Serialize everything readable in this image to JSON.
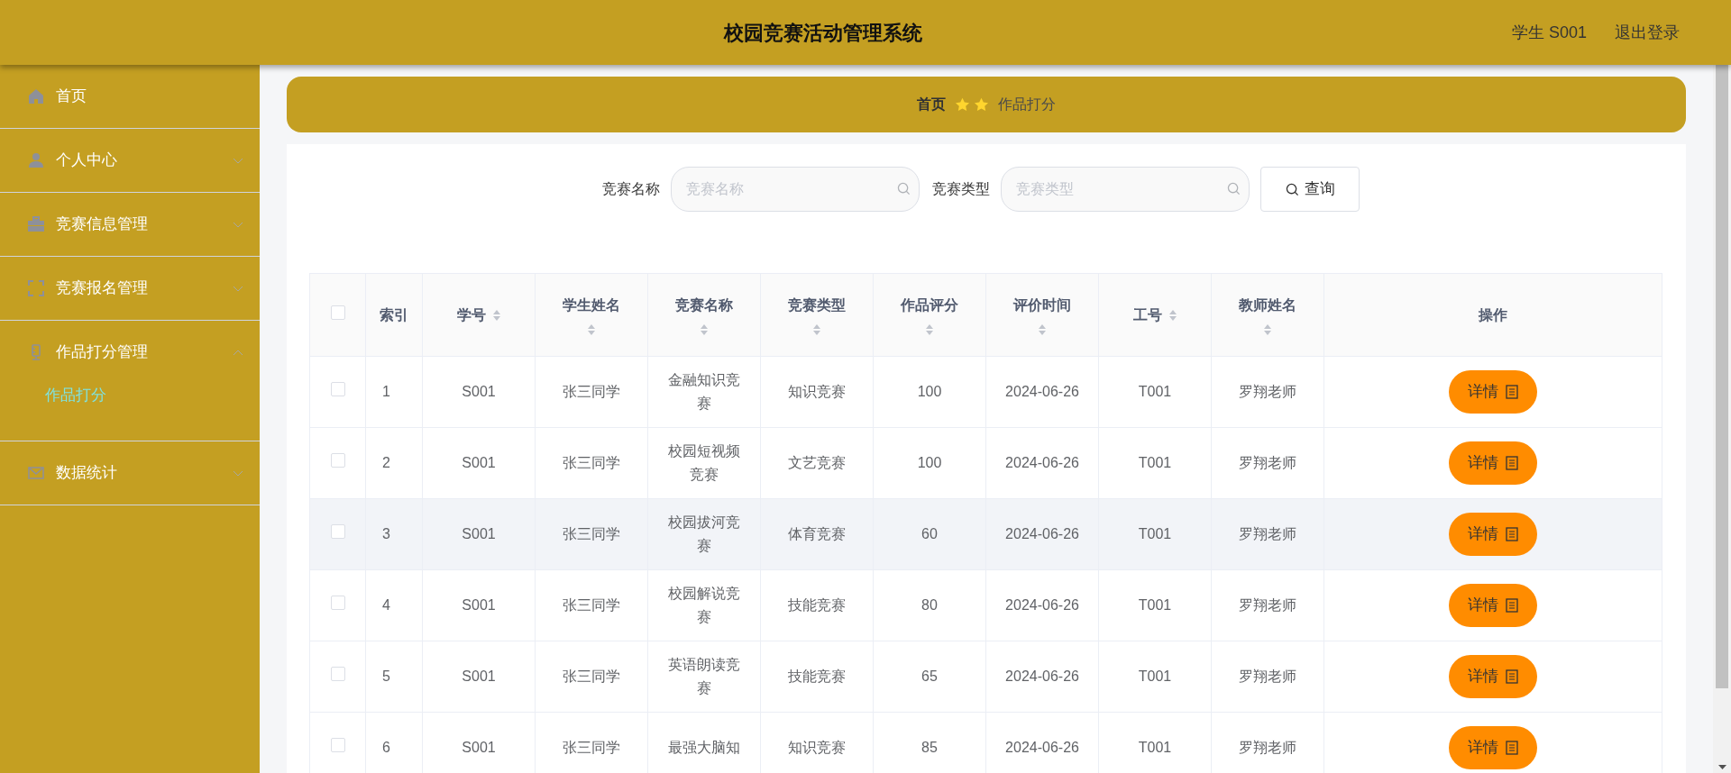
{
  "header": {
    "title": "校园竞赛活动管理系统",
    "user": "学生 S001",
    "logout": "退出登录"
  },
  "sidebar": {
    "items": [
      {
        "label": "首页"
      },
      {
        "label": "个人中心",
        "expanded": false
      },
      {
        "label": "竞赛信息管理",
        "expanded": false
      },
      {
        "label": "竞赛报名管理",
        "expanded": false
      },
      {
        "label": "作品打分管理",
        "expanded": true,
        "children": [
          {
            "label": "作品打分",
            "selected": true
          }
        ]
      },
      {
        "label": "数据统计",
        "expanded": false
      }
    ]
  },
  "breadcrumb": {
    "home": "首页",
    "current": "作品打分"
  },
  "search": {
    "fields": [
      {
        "label": "竞赛名称",
        "placeholder": "竞赛名称"
      },
      {
        "label": "竞赛类型",
        "placeholder": "竞赛类型"
      }
    ],
    "button": "查询"
  },
  "table": {
    "select_all_checked": false,
    "columns": [
      {
        "label": "索引",
        "sortable": false
      },
      {
        "label": "学号",
        "sortable": true
      },
      {
        "label": "学生姓名",
        "sortable": true
      },
      {
        "label": "竞赛名称",
        "sortable": true
      },
      {
        "label": "竞赛类型",
        "sortable": true
      },
      {
        "label": "作品评分",
        "sortable": true
      },
      {
        "label": "评价时间",
        "sortable": true
      },
      {
        "label": "工号",
        "sortable": true
      },
      {
        "label": "教师姓名",
        "sortable": true
      },
      {
        "label": "操作",
        "sortable": false
      }
    ],
    "rows": [
      {
        "checked": false,
        "highlighted": false,
        "cells": [
          "1",
          "S001",
          "张三同学",
          "金融知识竞赛",
          "知识竞赛",
          "100",
          "2024-06-26",
          "T001",
          "罗翔老师"
        ],
        "action": "详情"
      },
      {
        "checked": false,
        "highlighted": false,
        "cells": [
          "2",
          "S001",
          "张三同学",
          "校园短视频竞赛",
          "文艺竞赛",
          "100",
          "2024-06-26",
          "T001",
          "罗翔老师"
        ],
        "action": "详情"
      },
      {
        "checked": false,
        "highlighted": true,
        "cells": [
          "3",
          "S001",
          "张三同学",
          "校园拔河竞赛",
          "体育竞赛",
          "60",
          "2024-06-26",
          "T001",
          "罗翔老师"
        ],
        "action": "详情"
      },
      {
        "checked": false,
        "highlighted": false,
        "cells": [
          "4",
          "S001",
          "张三同学",
          "校园解说竞赛",
          "技能竞赛",
          "80",
          "2024-06-26",
          "T001",
          "罗翔老师"
        ],
        "action": "详情"
      },
      {
        "checked": false,
        "highlighted": false,
        "cells": [
          "5",
          "S001",
          "张三同学",
          "英语朗读竞赛",
          "技能竞赛",
          "65",
          "2024-06-26",
          "T001",
          "罗翔老师"
        ],
        "action": "详情"
      },
      {
        "checked": false,
        "highlighted": false,
        "cells": [
          "6",
          "S001",
          "张三同学",
          "最强大脑知",
          "知识竞赛",
          "85",
          "2024-06-26",
          "T001",
          "罗翔老师"
        ],
        "action": "详情"
      }
    ]
  }
}
